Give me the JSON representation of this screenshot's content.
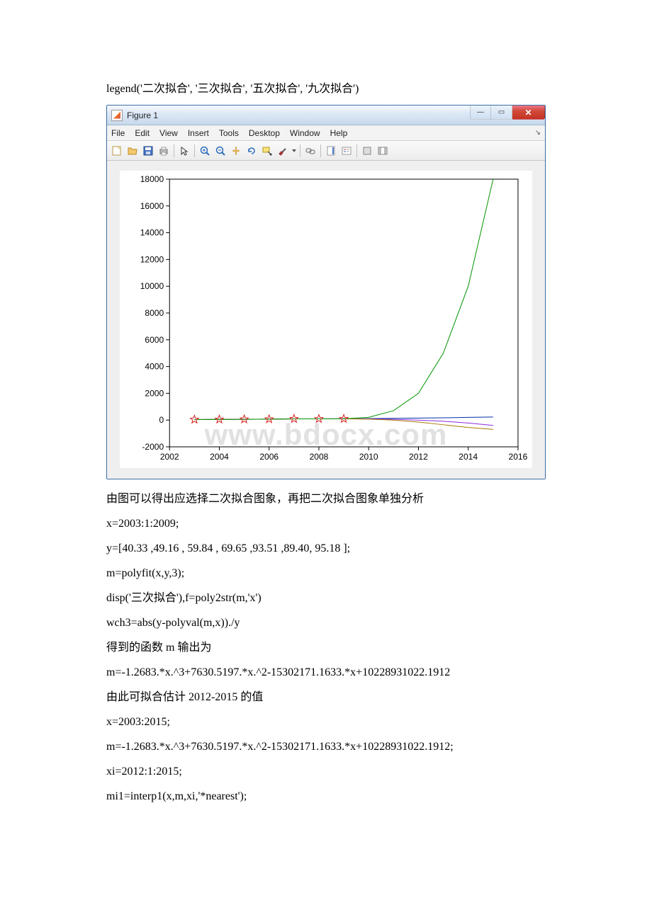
{
  "doc": {
    "line_legend": "legend('二次拟合', '三次拟合', '五次拟合', '九次拟合')",
    "after_fig_1": "由图可以得出应选择二次拟合图象，再把二次拟合图象单独分析",
    "after_fig_2": "x=2003:1:2009;",
    "after_fig_3": "y=[40.33 ,49.16 , 59.84 , 69.65 ,93.51 ,89.40, 95.18 ];",
    "after_fig_4": "m=polyfit(x,y,3);",
    "after_fig_5": "disp('三次拟合'),f=poly2str(m,'x')",
    "after_fig_6": "wch3=abs(y-polyval(m,x))./y",
    "after_fig_7": "得到的函数 m 输出为",
    "after_fig_8": "m=-1.2683.*x.^3+7630.5197.*x.^2-15302171.1633.*x+10228931022.1912",
    "after_fig_9": "由此可拟合估计 2012-2015 的值",
    "after_fig_10": "x=2003:2015;",
    "after_fig_11": "m=-1.2683.*x.^3+7630.5197.*x.^2-15302171.1633.*x+10228931022.1912;",
    "after_fig_12": "xi=2012:1:2015;",
    "after_fig_13": "mi1=interp1(x,m,xi,'*nearest');"
  },
  "figure": {
    "title": "Figure 1",
    "menu": [
      "File",
      "Edit",
      "View",
      "Insert",
      "Tools",
      "Desktop",
      "Window",
      "Help"
    ]
  },
  "watermark": "www.bdocx.com",
  "chart_data": {
    "type": "line",
    "title": "",
    "xlabel": "",
    "ylabel": "",
    "xlim": [
      2002,
      2016
    ],
    "ylim": [
      -2000,
      18000
    ],
    "xticks": [
      2002,
      2004,
      2006,
      2008,
      2010,
      2012,
      2014,
      2016
    ],
    "yticks": [
      -2000,
      0,
      2000,
      4000,
      6000,
      8000,
      10000,
      12000,
      14000,
      16000,
      18000
    ],
    "markers": {
      "x": [
        2003,
        2004,
        2005,
        2006,
        2007,
        2008,
        2009
      ],
      "y": [
        40.33,
        49.16,
        59.84,
        69.65,
        93.51,
        89.4,
        95.18
      ],
      "style": "red pentagram"
    },
    "series": [
      {
        "name": "二次拟合",
        "color": "#0030aa",
        "x": [
          2003,
          2004,
          2005,
          2006,
          2007,
          2008,
          2009,
          2010,
          2011,
          2012,
          2013,
          2014,
          2015
        ],
        "y": [
          40,
          50,
          60,
          70,
          90,
          90,
          95,
          110,
          130,
          150,
          170,
          200,
          230
        ]
      },
      {
        "name": "三次拟合",
        "color": "#8a2be2",
        "x": [
          2003,
          2004,
          2005,
          2006,
          2007,
          2008,
          2009,
          2010,
          2011,
          2012,
          2013,
          2014,
          2015
        ],
        "y": [
          40,
          50,
          60,
          70,
          90,
          90,
          95,
          90,
          60,
          0,
          -90,
          -220,
          -400
        ]
      },
      {
        "name": "五次拟合",
        "color": "#aa7a00",
        "x": [
          2003,
          2004,
          2005,
          2006,
          2007,
          2008,
          2009,
          2010,
          2011,
          2012,
          2013,
          2014,
          2015
        ],
        "y": [
          40,
          50,
          60,
          70,
          90,
          90,
          95,
          70,
          0,
          -150,
          -350,
          -550,
          -700
        ]
      },
      {
        "name": "九次拟合",
        "color": "#009500",
        "x": [
          2003,
          2004,
          2005,
          2006,
          2007,
          2008,
          2009,
          2010,
          2011,
          2012,
          2013,
          2014,
          2015
        ],
        "y": [
          40,
          50,
          60,
          70,
          90,
          90,
          95,
          200,
          700,
          2000,
          5000,
          10000,
          18000
        ]
      }
    ]
  }
}
